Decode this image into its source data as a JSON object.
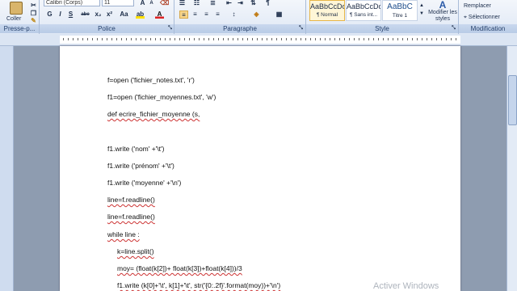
{
  "clipboard": {
    "paste_label": "Coller",
    "group_label": "Presse-p..."
  },
  "font": {
    "font_name": "Calibri (Corps)",
    "font_size": "11",
    "group_label": "Police",
    "bold": "G",
    "italic": "I",
    "underline": "S",
    "strike": "abe",
    "sub": "x₂",
    "sup": "x²",
    "case": "Aa",
    "grow": "A",
    "color": "A"
  },
  "paragraph": {
    "group_label": "Paragraphe"
  },
  "styles": {
    "group_label": "Style",
    "items": [
      {
        "sample": "AaBbCcDc",
        "name": "¶ Normal"
      },
      {
        "sample": "AaBbCcDc",
        "name": "¶ Sans int..."
      },
      {
        "sample": "AaBbC",
        "name": "Titre 1"
      }
    ],
    "change_label": "Modifier les styles"
  },
  "editing": {
    "group_label": "Modification",
    "replace_label": "Remplacer",
    "select_label": "Sélectionner"
  },
  "document": {
    "lines": [
      "f=open ('fichier_notes.txt', 'r')",
      "f1=open ('fichier_moyennes.txt', 'w')",
      "def ecrire_fichier_moyenne (s,",
      "f1.write ('nom' +'\\t')",
      "f1.write ('prénom' +'\\t')",
      "f1.write ('moyenne' +'\\n')",
      "line=f.readline()",
      "line=f.readline()",
      "while line :",
      "k=line.split()",
      "moy= (float(k[2])+ float(k[3])+float(k[4]))/3",
      "f1.write (k[0]+'\\t', k[1]+'\\t', str('{0:.2f}'.format(moy))+'\\n')"
    ]
  },
  "watermark": "Activer Windows"
}
